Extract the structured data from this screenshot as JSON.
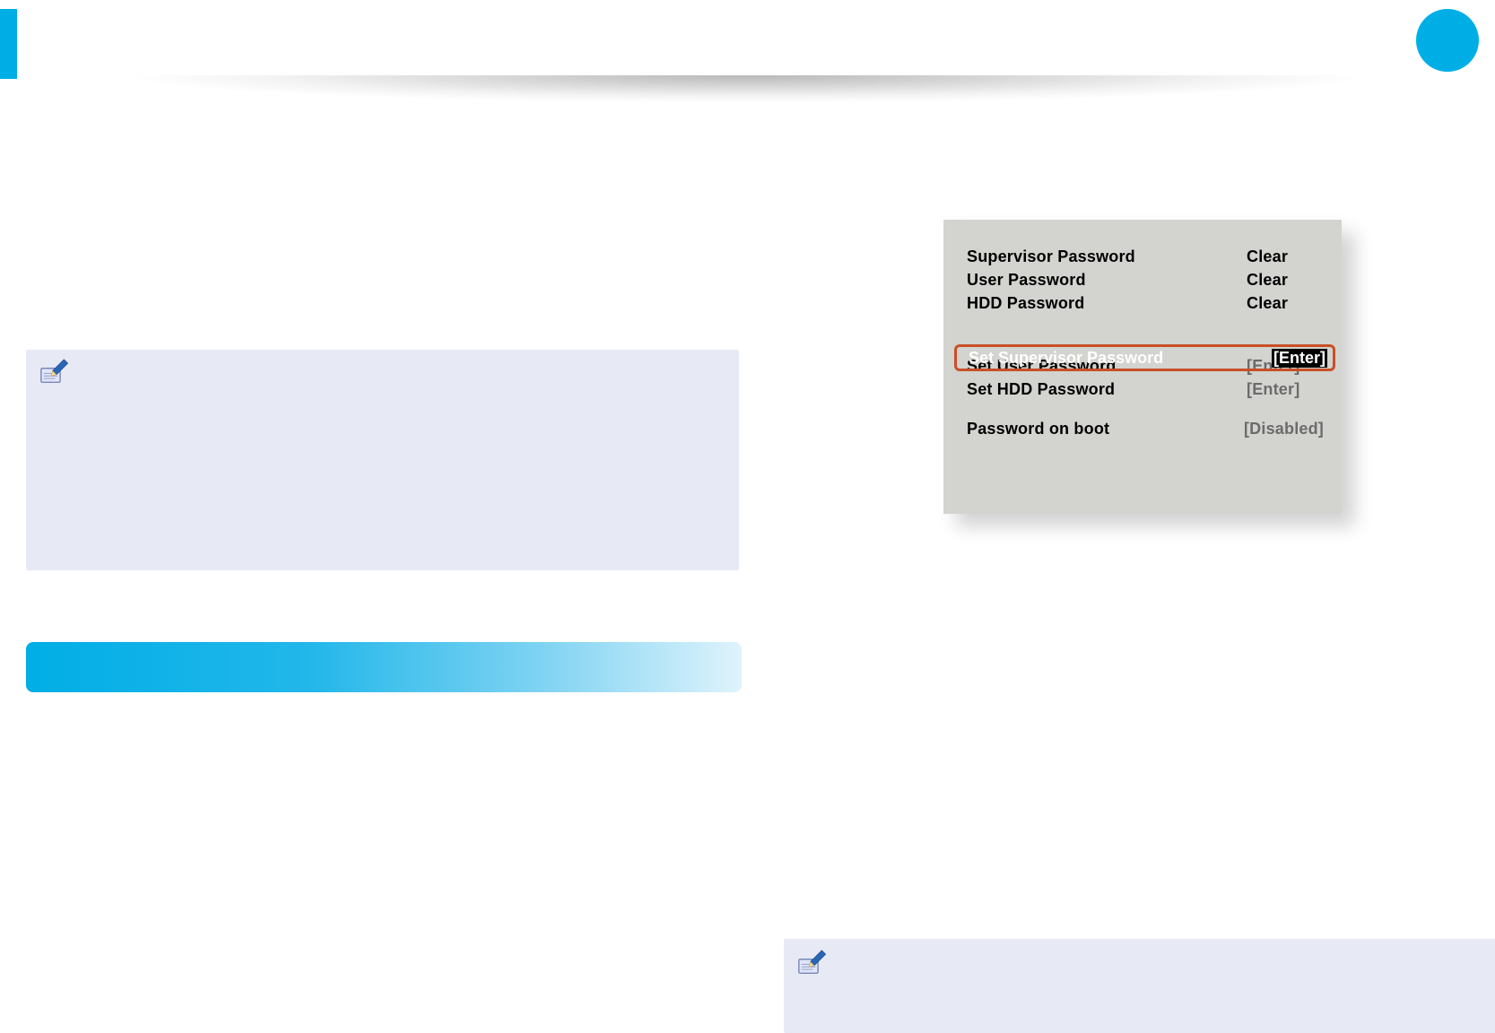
{
  "accent_color": "#00aee6",
  "bios_panel": {
    "rows_status": [
      {
        "label": "Supervisor Password",
        "value": "Clear"
      },
      {
        "label": "User Password",
        "value": "Clear"
      },
      {
        "label": "HDD Password",
        "value": "Clear"
      }
    ],
    "highlight": {
      "label": "Set Supervisor Password",
      "value": "[Enter]"
    },
    "rows_set": [
      {
        "label": "Set User Password",
        "value": "[Enter]"
      },
      {
        "label": "Set HDD Password",
        "value": "[Enter]"
      }
    ],
    "row_boot": {
      "label": "Password on boot",
      "value": "[Disabled]"
    }
  }
}
